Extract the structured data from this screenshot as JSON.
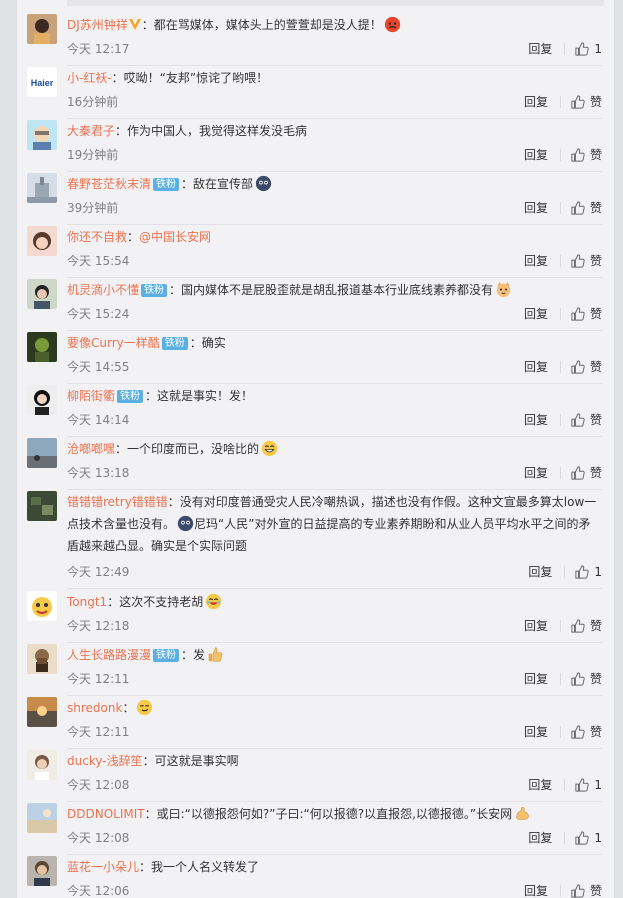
{
  "comments": [
    {
      "user": "DJ苏州钟祥",
      "vip": true,
      "text": "：都在骂媒体，媒体头上的萱萱却是没人提！",
      "emoji": "angry-emoji",
      "time": "今天 12:17",
      "reply": "回复",
      "likes": "1"
    },
    {
      "user": "小-红袄-",
      "text": "：哎呦！“友邦”惊诧了哟喂！",
      "time": "16分钟前",
      "reply": "回复",
      "likes": "赞"
    },
    {
      "user": "大秦君子",
      "text": "：作为中国人，我觉得这样发没毛病",
      "time": "19分钟前",
      "reply": "回复",
      "likes": "赞"
    },
    {
      "user": "春野苍茫秋末清",
      "badge": "铁粉",
      "text": "：敌在宣传部",
      "emoji": "doge-emoji",
      "time": "39分钟前",
      "reply": "回复",
      "likes": "赞"
    },
    {
      "user": "你还不自救",
      "text": "：",
      "mention": "@中国长安网",
      "time": "今天 15:54",
      "reply": "回复",
      "likes": "赞"
    },
    {
      "user": "机灵滴小不懂",
      "badge": "铁粉",
      "text": "：国内媒体不是屁股歪就是胡乱报道基本行业底线素养都没有",
      "emoji": "cat-emoji",
      "time": "今天 15:24",
      "reply": "回复",
      "likes": "赞"
    },
    {
      "user": "要像Curry一样酷",
      "badge": "铁粉",
      "text": "：确实",
      "time": "今天 14:55",
      "reply": "回复",
      "likes": "赞"
    },
    {
      "user": "柳陌街衢",
      "badge": "铁粉",
      "text": "：这就是事实！发！",
      "time": "今天 14:14",
      "reply": "回复",
      "likes": "赞"
    },
    {
      "user": "沧啷啷嘿",
      "text": "：一个印度而已，没啥比的",
      "emoji": "grin-emoji",
      "time": "今天 13:18",
      "reply": "回复",
      "likes": "赞"
    },
    {
      "user": "错错错retry错错错",
      "text": "：没有对印度普通受灾人民冷嘲热讽，描述也没有作假。这种文宣最多算太low一点技术含量也没有。",
      "emoji": "doge-emoji",
      "text2": "尼玛“人民”对外宣的日益提高的专业素养期盼和从业人员平均水平之间的矛盾越来越凸显。确实是个实际问题",
      "time": "今天 12:49",
      "reply": "回复",
      "likes": "1"
    },
    {
      "user": "Tongt1",
      "text": "：这次不支持老胡",
      "emoji": "laugh-cry-emoji",
      "time": "今天 12:18",
      "reply": "回复",
      "likes": "赞"
    },
    {
      "user": "人生长路路漫漫",
      "badge": "铁粉",
      "text": "：发",
      "emoji": "thumbs-up-emoji",
      "time": "今天 12:11",
      "reply": "回复",
      "likes": "赞"
    },
    {
      "user": "shredonk",
      "text": "：",
      "emoji": "smirk-emoji",
      "time": "今天 12:11",
      "reply": "回复",
      "likes": "赞"
    },
    {
      "user": "ducky-浅辞笙",
      "text": "：可这就是事实啊",
      "time": "今天 12:08",
      "reply": "回复",
      "likes": "1"
    },
    {
      "user": "DDDNOLIMIT",
      "text": "：或曰:“以德报怨何如?”子曰:“何以报德?以直报怨,以德报德。”长安网",
      "emoji": "strong-emoji",
      "time": "今天 12:08",
      "reply": "回复",
      "likes": "1"
    },
    {
      "user": "蓝花一小朵儿",
      "text": "：我一个人名义转发了",
      "time": "今天 12:06",
      "reply": "回复",
      "likes": "赞"
    }
  ],
  "colors": {
    "username": "#eb7350",
    "badge": "#5bb0e3",
    "background": "#f2f2f5"
  }
}
